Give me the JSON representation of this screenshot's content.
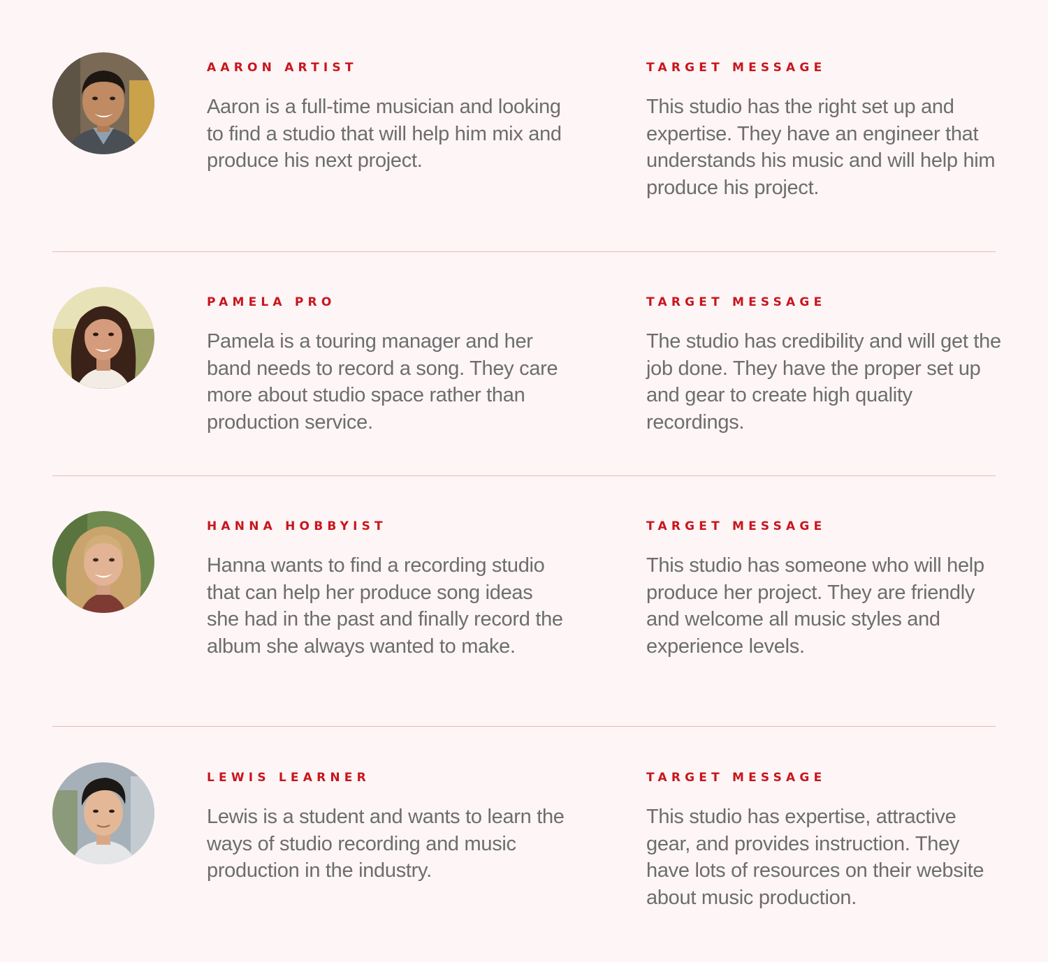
{
  "colors": {
    "background": "#fdf5f6",
    "accent": "#c8161d",
    "body_text": "#6d6d6d",
    "divider": "#ebb8ba"
  },
  "personas": [
    {
      "name": "AARON ARTIST",
      "avatar_icon": "person-photo-icon",
      "description": "Aaron is a full-time musician and looking to find a studio that will help him mix and produce his next project.",
      "message_label": "TARGET MESSAGE",
      "message": "This studio has the right set up and expertise. They have an engineer that understands his music and will help him produce his project."
    },
    {
      "name": "PAMELA PRO",
      "avatar_icon": "person-photo-icon",
      "description": "Pamela is a touring manager and her band needs to record a song. They care more about studio space rather than production service.",
      "message_label": "TARGET MESSAGE",
      "message": "The studio has credibility and will get the job done. They have the proper set up and gear to create high quality recordings."
    },
    {
      "name": "HANNA HOBBYIST",
      "avatar_icon": "person-photo-icon",
      "description": "Hanna wants to find a recording studio that can help her produce song ideas she had in the past and finally record the album she always wanted to make.",
      "message_label": "TARGET MESSAGE",
      "message": "This studio has someone who will help produce her project. They are friendly and welcome all music styles and experience levels."
    },
    {
      "name": "LEWIS LEARNER",
      "avatar_icon": "person-photo-icon",
      "description": "Lewis is a student and wants to learn the ways of studio recording and music production in the industry.",
      "message_label": "TARGET MESSAGE",
      "message": "This studio has expertise, attractive gear, and provides instruction. They have lots of resources on their website about music production."
    }
  ]
}
